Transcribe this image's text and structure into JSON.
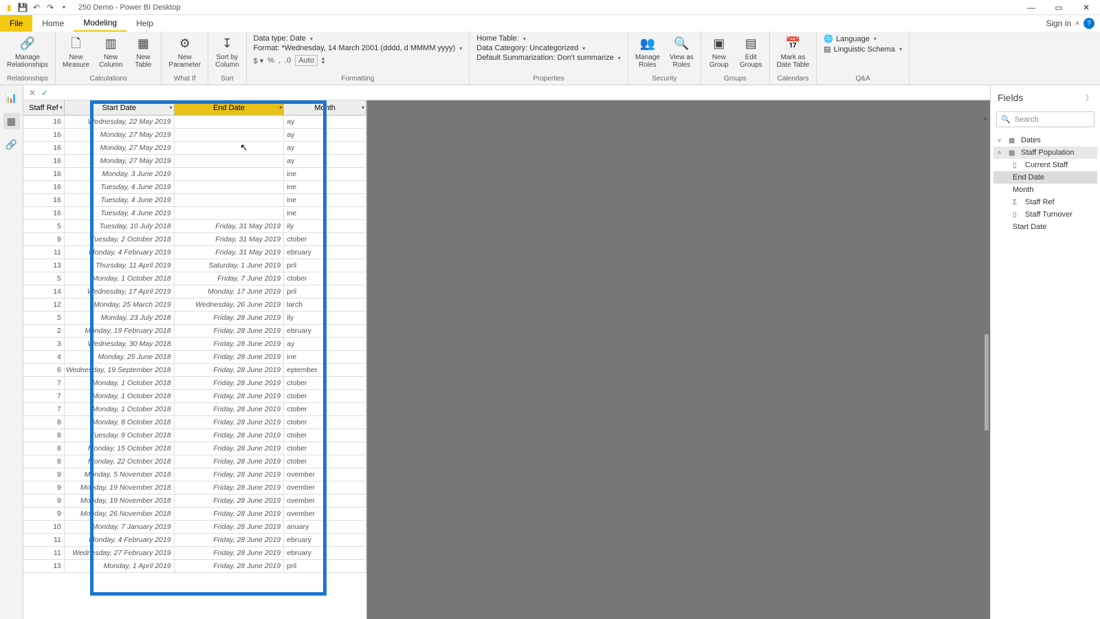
{
  "titlebar": {
    "title": "250 Demo - Power BI Desktop"
  },
  "win": {
    "minimize": "—",
    "restore": "▭",
    "close": "✕"
  },
  "menu": {
    "file": "File",
    "home": "Home",
    "modeling": "Modeling",
    "help": "Help",
    "signin": "Sign in"
  },
  "ribbon": {
    "relationships": {
      "manage": "Manage\nRelationships",
      "group": "Relationships"
    },
    "calculations": {
      "newmeasure": "New\nMeasure",
      "newcolumn": "New\nColumn",
      "newtable": "New\nTable",
      "group": "Calculations"
    },
    "whatif": {
      "newparameter": "New\nParameter",
      "group": "What If"
    },
    "sort": {
      "sortby": "Sort by\nColumn",
      "group": "Sort"
    },
    "formatting": {
      "datatype": "Data type: Date",
      "format": "Format: *Wednesday, 14 March 2001 (dddd, d MMMM yyyy)",
      "auto": "Auto",
      "group": "Formatting"
    },
    "properties": {
      "hometable": "Home Table:",
      "datacategory": "Data Category: Uncategorized",
      "defaultsumm": "Default Summarization: Don't summarize",
      "group": "Properties"
    },
    "security": {
      "manageroles": "Manage\nRoles",
      "viewas": "View as\nRoles",
      "group": "Security"
    },
    "groups": {
      "newgroup": "New\nGroup",
      "editgroups": "Edit\nGroups",
      "group": "Groups"
    },
    "calendars": {
      "markas": "Mark as\nDate Table",
      "group": "Calendars"
    },
    "qa": {
      "language": "Language",
      "schema": "Linguistic Schema",
      "group": "Q&A"
    }
  },
  "table": {
    "headers": {
      "staffref": "Staff Ref",
      "startdate": "Start Date",
      "enddate": "End Date",
      "month": "Month"
    },
    "rows": [
      {
        "staffref": "16",
        "start": "Wednesday, 22 May 2019",
        "end": "",
        "month": "ay"
      },
      {
        "staffref": "16",
        "start": "Monday, 27 May 2019",
        "end": "",
        "month": "ay"
      },
      {
        "staffref": "16",
        "start": "Monday, 27 May 2019",
        "end": "",
        "month": "ay"
      },
      {
        "staffref": "16",
        "start": "Monday, 27 May 2019",
        "end": "",
        "month": "ay"
      },
      {
        "staffref": "16",
        "start": "Monday, 3 June 2019",
        "end": "",
        "month": "ine"
      },
      {
        "staffref": "16",
        "start": "Tuesday, 4 June 2019",
        "end": "",
        "month": "ine"
      },
      {
        "staffref": "16",
        "start": "Tuesday, 4 June 2019",
        "end": "",
        "month": "ine"
      },
      {
        "staffref": "16",
        "start": "Tuesday, 4 June 2019",
        "end": "",
        "month": "ine"
      },
      {
        "staffref": "5",
        "start": "Tuesday, 10 July 2018",
        "end": "Friday, 31 May 2019",
        "month": "ily"
      },
      {
        "staffref": "9",
        "start": "Tuesday, 2 October 2018",
        "end": "Friday, 31 May 2019",
        "month": "ctober"
      },
      {
        "staffref": "11",
        "start": "Monday, 4 February 2019",
        "end": "Friday, 31 May 2019",
        "month": "ebruary"
      },
      {
        "staffref": "13",
        "start": "Thursday, 11 April 2019",
        "end": "Saturday, 1 June 2019",
        "month": "pril"
      },
      {
        "staffref": "5",
        "start": "Monday, 1 October 2018",
        "end": "Friday, 7 June 2019",
        "month": "ctober"
      },
      {
        "staffref": "14",
        "start": "Wednesday, 17 April 2019",
        "end": "Monday, 17 June 2019",
        "month": "pril"
      },
      {
        "staffref": "12",
        "start": "Monday, 25 March 2019",
        "end": "Wednesday, 26 June 2019",
        "month": "larch"
      },
      {
        "staffref": "5",
        "start": "Monday, 23 July 2018",
        "end": "Friday, 28 June 2019",
        "month": "ily"
      },
      {
        "staffref": "2",
        "start": "Monday, 19 February 2018",
        "end": "Friday, 28 June 2019",
        "month": "ebruary"
      },
      {
        "staffref": "3",
        "start": "Wednesday, 30 May 2018",
        "end": "Friday, 28 June 2019",
        "month": "ay"
      },
      {
        "staffref": "4",
        "start": "Monday, 25 June 2018",
        "end": "Friday, 28 June 2019",
        "month": "ine"
      },
      {
        "staffref": "6",
        "start": "Wednesday, 19 September 2018",
        "end": "Friday, 28 June 2019",
        "month": "eptember"
      },
      {
        "staffref": "7",
        "start": "Monday, 1 October 2018",
        "end": "Friday, 28 June 2019",
        "month": "ctober"
      },
      {
        "staffref": "7",
        "start": "Monday, 1 October 2018",
        "end": "Friday, 28 June 2019",
        "month": "ctober"
      },
      {
        "staffref": "7",
        "start": "Monday, 1 October 2018",
        "end": "Friday, 28 June 2019",
        "month": "ctober"
      },
      {
        "staffref": "8",
        "start": "Monday, 8 October 2018",
        "end": "Friday, 28 June 2019",
        "month": "ctober"
      },
      {
        "staffref": "8",
        "start": "Tuesday, 9 October 2018",
        "end": "Friday, 28 June 2019",
        "month": "ctober"
      },
      {
        "staffref": "8",
        "start": "Monday, 15 October 2018",
        "end": "Friday, 28 June 2019",
        "month": "ctober"
      },
      {
        "staffref": "8",
        "start": "Monday, 22 October 2018",
        "end": "Friday, 28 June 2019",
        "month": "ctober"
      },
      {
        "staffref": "9",
        "start": "Monday, 5 November 2018",
        "end": "Friday, 28 June 2019",
        "month": "ovember"
      },
      {
        "staffref": "9",
        "start": "Monday, 19 November 2018",
        "end": "Friday, 28 June 2019",
        "month": "ovember"
      },
      {
        "staffref": "9",
        "start": "Monday, 19 November 2018",
        "end": "Friday, 28 June 2019",
        "month": "ovember"
      },
      {
        "staffref": "9",
        "start": "Monday, 26 November 2018",
        "end": "Friday, 28 June 2019",
        "month": "ovember"
      },
      {
        "staffref": "10",
        "start": "Monday, 7 January 2019",
        "end": "Friday, 28 June 2019",
        "month": "anuary"
      },
      {
        "staffref": "11",
        "start": "Monday, 4 February 2019",
        "end": "Friday, 28 June 2019",
        "month": "ebruary"
      },
      {
        "staffref": "11",
        "start": "Wednesday, 27 February 2019",
        "end": "Friday, 28 June 2019",
        "month": "ebruary"
      },
      {
        "staffref": "13",
        "start": "Monday, 1 April 2019",
        "end": "Friday, 28 June 2019",
        "month": "pril"
      }
    ]
  },
  "fields": {
    "title": "Fields",
    "search": "Search",
    "dates": "Dates",
    "staffpop": "Staff Population",
    "currentstaff": "Current Staff",
    "enddate": "End Date",
    "month": "Month",
    "staffref": "Staff Ref",
    "staffturnover": "Staff Turnover",
    "startdate": "Start Date"
  }
}
